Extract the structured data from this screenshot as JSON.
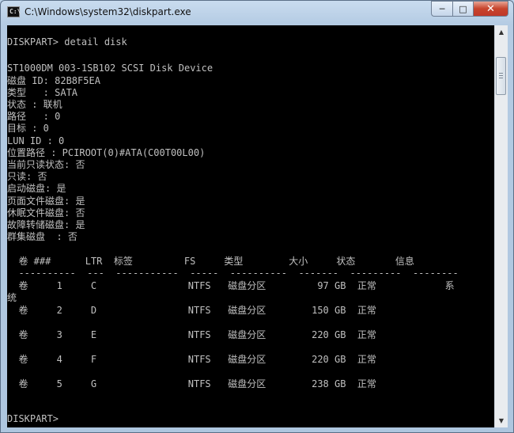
{
  "window": {
    "title": "C:\\Windows\\system32\\diskpart.exe",
    "controls": {
      "minimize": "─",
      "maximize": "□",
      "close": "✕"
    }
  },
  "console": {
    "lines": [
      "DISKPART> detail disk",
      "ST1000DM 003-1SB102 SCSI Disk Device",
      "磁盘 ID: 82B8F5EA",
      "类型   : SATA",
      "状态 : 联机",
      "路径   : 0",
      "目标 : 0",
      "LUN ID : 0",
      "位置路径 : PCIROOT(0)#ATA(C00T00L00)",
      "当前只读状态: 否",
      "只读: 否",
      "启动磁盘: 是",
      "页面文件磁盘: 是",
      "休眠文件磁盘: 否",
      "故障转储磁盘: 是",
      "群集磁盘  : 否",
      "  卷 ###      LTR  标签         FS     类型        大小     状态       信息",
      "  ----------  ---  -----------  -----  ----------  -------  ---------  --------",
      "  卷     1     C                NTFS   磁盘分区         97 GB  正常            系",
      "统",
      "  卷     2     D                NTFS   磁盘分区        150 GB  正常",
      "  卷     3     E                NTFS   磁盘分区        220 GB  正常",
      "  卷     4     F                NTFS   磁盘分区        220 GB  正常",
      "  卷     5     G                NTFS   磁盘分区        238 GB  正常",
      "DISKPART>"
    ]
  },
  "scrollbar": {
    "up_arrow": "▲",
    "down_arrow": "▼"
  }
}
